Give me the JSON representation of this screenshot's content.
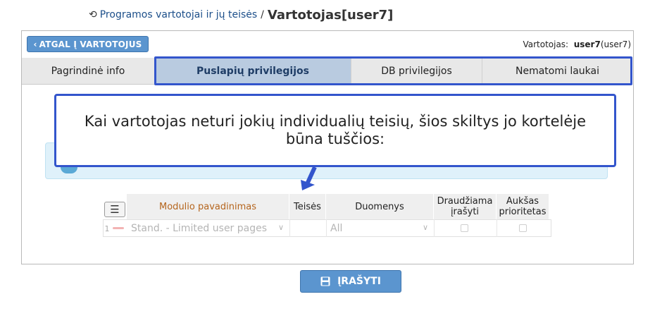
{
  "breadcrumb": {
    "history_icon": "history-icon",
    "parent_link": "Programos vartotojai ir jų teisės",
    "separator": "/",
    "title": "Vartotojas[user7]"
  },
  "header": {
    "back_button": "ATGAL Į VARTOTOJUS",
    "user_label": "Vartotojas:",
    "user_name": "user7",
    "user_detail": "(user7)"
  },
  "tabs": [
    {
      "label": "Pagrindinė info",
      "active": false
    },
    {
      "label": "Puslapių privilegijos",
      "active": true
    },
    {
      "label": "DB privilegijos",
      "active": false
    },
    {
      "label": "Nematomi laukai",
      "active": false
    }
  ],
  "callout": {
    "text": "Kai vartotojas neturi jokių individualių teisių, šios skiltys jo kortelėje būna tuščios:"
  },
  "table": {
    "columns": [
      "Modulio pavadinimas",
      "Teisės",
      "Duomenys",
      "Draudžiama įrašyti",
      "Aukšas prioritetas"
    ],
    "rows": [
      {
        "num": "1",
        "module": "Stand. - Limited user pages",
        "rights": "",
        "data": "All",
        "no_write": false,
        "high_priority": false
      }
    ]
  },
  "save_button": "ĮRAŠYTI",
  "colors": {
    "accent_blue": "#5b95cf",
    "highlight_border": "#3355cc",
    "active_tab": "#b9cbe0",
    "column_header_orange": "#b5651d"
  }
}
